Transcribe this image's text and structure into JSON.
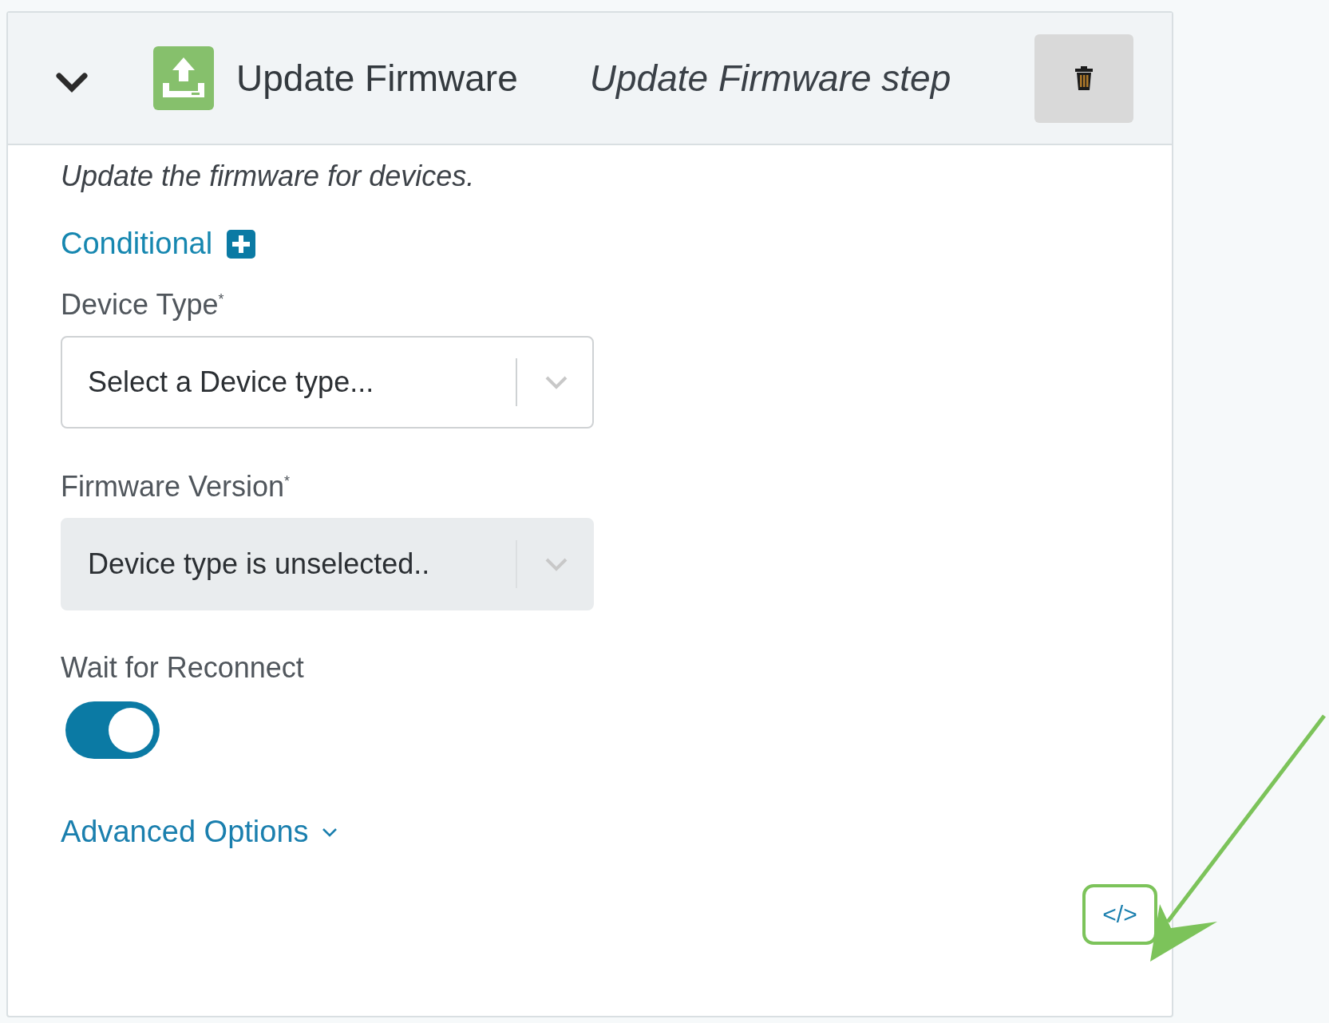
{
  "step": {
    "expanded": true,
    "title": "Update Firmware",
    "name": "Update Firmware step"
  },
  "description": "Update the firmware for devices.",
  "conditional": {
    "label": "Conditional"
  },
  "fields": [
    {
      "kind": "select",
      "label": "Device Type",
      "required_mark": "*",
      "placeholder": "Select a Device type...",
      "disabled": false
    },
    {
      "kind": "select",
      "label": "Firmware Version",
      "required_mark": "*",
      "placeholder": "Device type is unselected..",
      "disabled": true
    }
  ],
  "toggle": {
    "label": "Wait for Reconnect",
    "on": true
  },
  "advanced": {
    "label": "Advanced Options",
    "expanded": false
  },
  "code_button": {
    "label": "</>",
    "highlighted": true
  }
}
